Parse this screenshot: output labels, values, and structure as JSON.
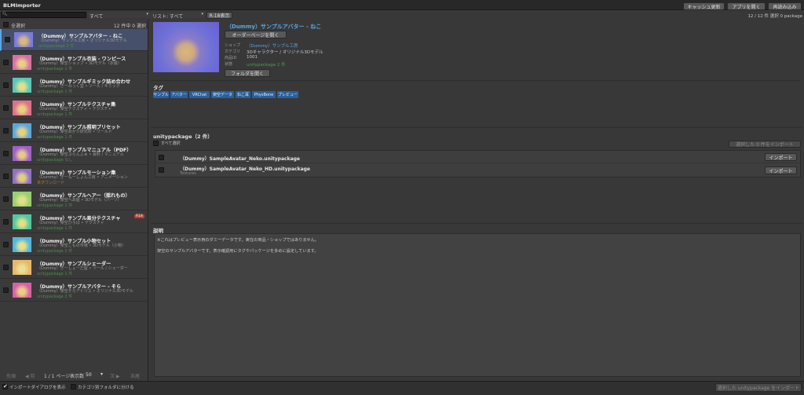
{
  "window": {
    "title": "BLMImporter"
  },
  "toolbar": {
    "search_placeholder": "",
    "filter1": "すべて",
    "filter2": "リスト: すべて",
    "r18_button": "R-18表示",
    "cache_button": "キャッシュ更新",
    "open_app_button": "アプリを開く",
    "reload_button": "再読み込み",
    "right_status": "12 / 12 件 選択 0 package"
  },
  "list": {
    "select_all_label": "全選択",
    "count_label": "12 件中 0 選択",
    "items": [
      {
        "title": "（Dummy）サンプルアバター - ねこ",
        "shop": "（Dummy）サンプル工房",
        "category": "オリジナル3Dモデル",
        "packages": "unitypackage 2 件",
        "colors": [
          "#7a7cd8",
          "#d9b878"
        ],
        "selected": true
      },
      {
        "title": "（Dummy）サンプル衣装 - ワンピース",
        "shop": "（Dummy）架空ショップ",
        "category": "3Dモデル（衣装）",
        "packages": "unitypackage 2 件",
        "colors": [
          "#d870a8",
          "#e8d080"
        ]
      },
      {
        "title": "（Dummy）サンプルギミック詰め合わせ",
        "shop": "（Dummy）ぎーみっく堂",
        "category": "ツール / ギミック",
        "packages": "unitypackage 1 件",
        "colors": [
          "#58c8b8",
          "#e0e088"
        ]
      },
      {
        "title": "（Dummy）サンプルテクスチャ集",
        "shop": "（Dummy）架空テクスチャ",
        "category": "テクスチャ",
        "packages": "unitypackage 1 件",
        "colors": [
          "#e0708a",
          "#e8d080"
        ]
      },
      {
        "title": "（Dummy）サンプル照明プリセット",
        "shop": "（Dummy）架空あかり研究所",
        "category": "ワールド",
        "packages": "unitypackage 1 件",
        "colors": [
          "#58a8e0",
          "#e8d080"
        ]
      },
      {
        "title": "（Dummy）サンプルマニュアル（PDF）",
        "shop": "（Dummy）架空ぷらんふぁ",
        "category": "資料 / マニュアル",
        "packages": "unitypackage なし",
        "colors": [
          "#a060c8",
          "#e8c888"
        ]
      },
      {
        "title": "（Dummy）サンプルモーション集",
        "shop": "（Dummy）ぎーもーしょん工房",
        "category": "アニメーション",
        "packages": "未ダウンロード",
        "colors": [
          "#9070c8",
          "#e0d080"
        ]
      },
      {
        "title": "（Dummy）サンプルヘアー（揺れもの）",
        "shop": "（Dummy）架空へあ屋",
        "category": "3Dモデル（パーツ）",
        "packages": "unitypackage 1 件",
        "colors": [
          "#98d070",
          "#e0e088"
        ]
      },
      {
        "title": "（Dummy）サンプル差分テクスチャ",
        "shop": "（Dummy）架空ひろば",
        "category": "テクスチャ",
        "packages": "unitypackage 1 件",
        "colors": [
          "#50c8a0",
          "#e0e088"
        ],
        "badge": "R18"
      },
      {
        "title": "（Dummy）サンプル小物セット",
        "shop": "（Dummy）架空こもの市場",
        "category": "3Dモデル（小物）",
        "packages": "unitypackage 2 件",
        "colors": [
          "#50b8e0",
          "#e8e088"
        ]
      },
      {
        "title": "（Dummy）サンプルシェーダー",
        "shop": "（Dummy）ぎーしぇーだ屋",
        "category": "ツール / シェーダー",
        "packages": "unitypackage 1 件",
        "colors": [
          "#e8b868",
          "#e8e098"
        ]
      },
      {
        "title": "（Dummy）サンプルアバター - そら",
        "shop": "（Dummy）架空そらアトリエ",
        "category": "オリジナル3Dモデル",
        "packages": "unitypackage 2 件",
        "colors": [
          "#d860a8",
          "#e8d080"
        ]
      }
    ]
  },
  "pager": {
    "first": "先頭",
    "prev": "◀ 前",
    "page_label": "1 / 1 ページ",
    "per_page_label": "表示数",
    "per_page_value": "50",
    "next": "次 ▶",
    "last": "末尾"
  },
  "detail": {
    "title": "（Dummy）サンプルアバター - ねこ",
    "order_button": "オーダーページを開く",
    "shop_label": "ショップ",
    "shop_value": "（Dummy）サンプル工房",
    "category_label": "カテゴリ",
    "category_value": "3Dキャラクター / オリジナル3Dモデル",
    "id_label": "商品ID",
    "id_value": "1001",
    "files_label": "状態",
    "files_value": "unitypackage 2 件",
    "folder_button": "フォルダを開く",
    "tags_heading": "タグ",
    "tags": [
      "サンプル",
      "アバター",
      "VRChat",
      "架空データ",
      "ねこ耳",
      "PhysBone",
      "プレビュー"
    ],
    "packages_heading": "unitypackage（2 件）",
    "packages_select_all": "すべて選択",
    "packages_import_selected": "選択した 0 件をインポート",
    "packages": [
      {
        "name": "（Dummy）SampleAvatar_Neko.unitypackage",
        "sub": "",
        "button": "インポート"
      },
      {
        "name": "（Dummy）SampleAvatar_Neko_HD.unitypackage",
        "sub": "Textures",
        "button": "インポート"
      }
    ],
    "desc_heading": "説明",
    "desc_lines": [
      "※これはプレビュー表示用のダミーデータです。実在の商品・ショップではありません。",
      "架空のサンプルアバターです。表示確認用にタグやパッケージを多めに設定しています。"
    ]
  },
  "footer": {
    "import_dialog_label": "インポートダイアログを表示",
    "category_folder_label": "カテゴリ別フォルダに分ける",
    "import_button": "選択した unitypackage をインポート"
  },
  "colors": {
    "accent": "#58a6e8",
    "tag_bg": "#2a5f9e",
    "green": "#4f9a4a",
    "badge": "#c0392b"
  }
}
